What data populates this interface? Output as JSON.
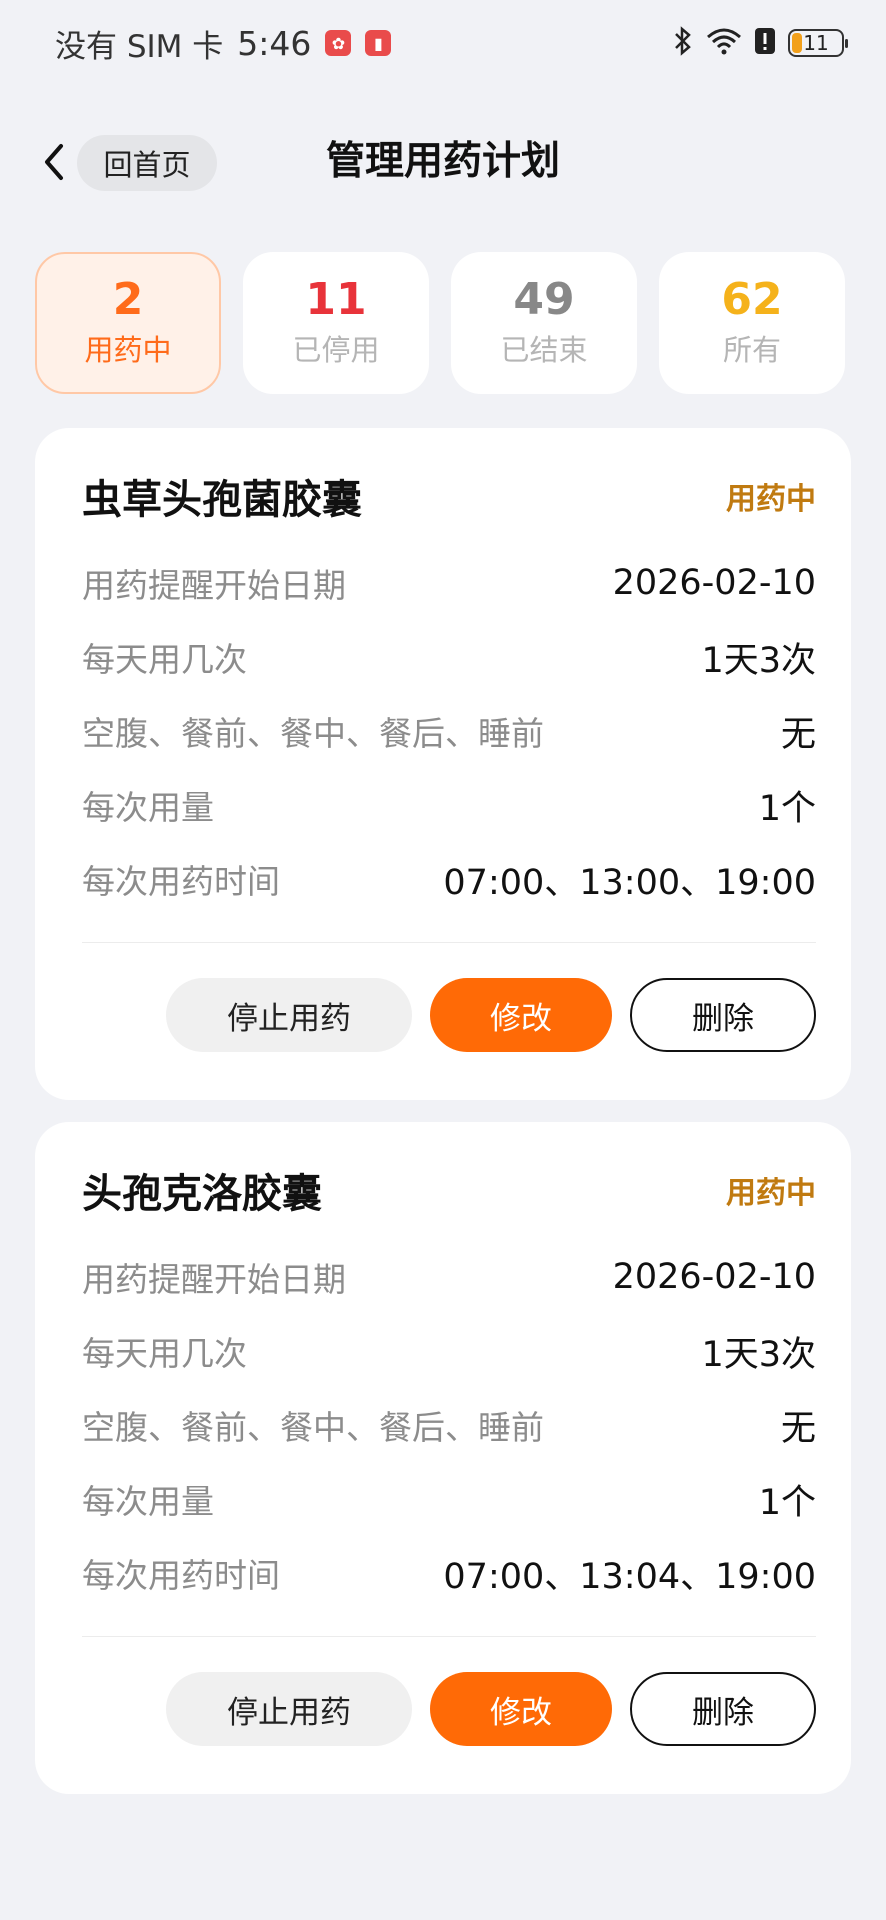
{
  "status_bar": {
    "carrier": "没有 SIM 卡",
    "time": "5:46",
    "battery": "11",
    "icons": [
      "huawei-notification-icon",
      "red-notification-icon",
      "bluetooth-icon",
      "wifi-icon",
      "alert-icon",
      "battery-icon"
    ]
  },
  "header": {
    "home_label": "回首页",
    "title": "管理用药计划"
  },
  "tabs": [
    {
      "count": "2",
      "label": "用药中",
      "color": "#ff6b1a",
      "active": true
    },
    {
      "count": "11",
      "label": "已停用",
      "color": "#e8333a",
      "active": false
    },
    {
      "count": "49",
      "label": "已结束",
      "color": "#888888",
      "active": false
    },
    {
      "count": "62",
      "label": "所有",
      "color": "#f5b21b",
      "active": false
    }
  ],
  "plans": [
    {
      "name": "虫草头孢菌胶囊",
      "status": "用药中",
      "rows": [
        {
          "label": "用药提醒开始日期",
          "value": "2026-02-10"
        },
        {
          "label": "每天用几次",
          "value": "1天3次"
        },
        {
          "label": "空腹、餐前、餐中、餐后、睡前",
          "value": "无"
        },
        {
          "label": "每次用量",
          "value": "1个"
        },
        {
          "label": "每次用药时间",
          "value": "07:00、13:00、19:00"
        }
      ],
      "actions": {
        "stop": "停止用药",
        "edit": "修改",
        "delete": "删除"
      }
    },
    {
      "name": "头孢克洛胶囊",
      "status": "用药中",
      "rows": [
        {
          "label": "用药提醒开始日期",
          "value": "2026-02-10"
        },
        {
          "label": "每天用几次",
          "value": "1天3次"
        },
        {
          "label": "空腹、餐前、餐中、餐后、睡前",
          "value": "无"
        },
        {
          "label": "每次用量",
          "value": "1个"
        },
        {
          "label": "每次用药时间",
          "value": "07:00、13:04、19:00"
        }
      ],
      "actions": {
        "stop": "停止用药",
        "edit": "修改",
        "delete": "删除"
      }
    }
  ]
}
